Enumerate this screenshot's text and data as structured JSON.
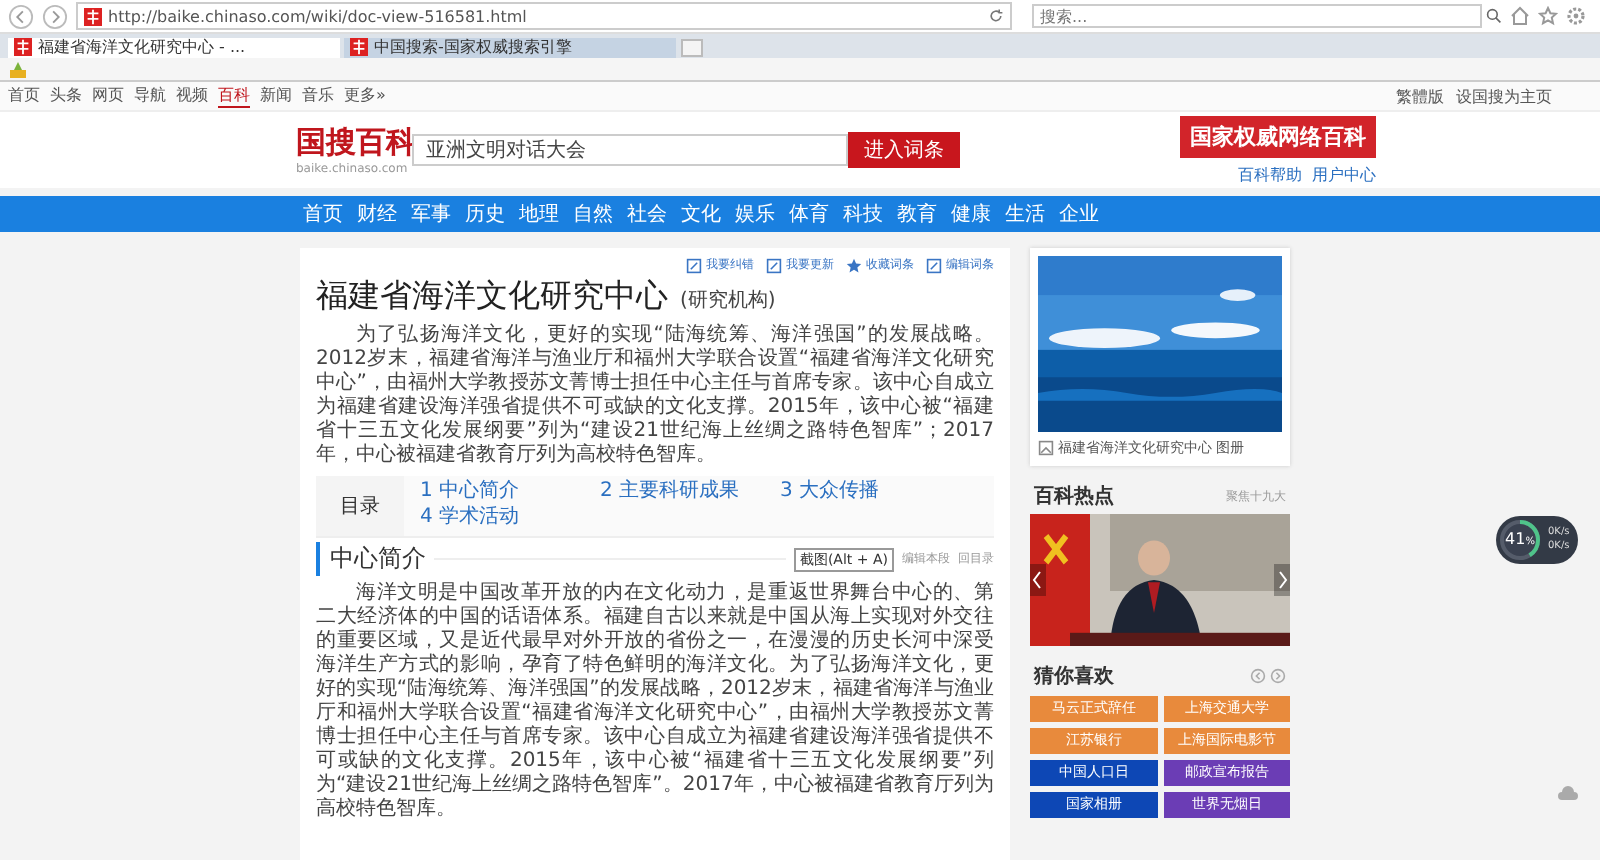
{
  "browser": {
    "url": "http://baike.chinaso.com/wiki/doc-view-516581.html",
    "search_placeholder": "搜索...",
    "tabs": [
      {
        "title": "福建省海洋文化研究中心 - ...",
        "selected": true
      },
      {
        "title": "中国搜索-国家权威搜索引擎",
        "selected": false
      }
    ]
  },
  "site": {
    "top_nav": [
      {
        "label": "首页",
        "selected": false
      },
      {
        "label": "头条",
        "selected": false
      },
      {
        "label": "网页",
        "selected": false
      },
      {
        "label": "导航",
        "selected": false
      },
      {
        "label": "视频",
        "selected": false
      },
      {
        "label": "百科",
        "selected": true
      },
      {
        "label": "新闻",
        "selected": false
      },
      {
        "label": "音乐",
        "selected": false
      },
      {
        "label": "更多»",
        "selected": false
      }
    ],
    "top_links": [
      "繁體版",
      "设国搜为主页"
    ],
    "logo": {
      "name": "国搜百科",
      "domain": "baike.chinaso.com"
    },
    "search": {
      "value": "亚洲文明对话大会",
      "button": "进入词条"
    },
    "banner": "国家权威网络百科",
    "header_links": [
      "百科帮助",
      "用户中心"
    ],
    "categories": [
      "首页",
      "财经",
      "军事",
      "历史",
      "地理",
      "自然",
      "社会",
      "文化",
      "娱乐",
      "体育",
      "科技",
      "教育",
      "健康",
      "生活",
      "企业"
    ]
  },
  "article": {
    "actions": [
      {
        "label": "我要纠错",
        "kind": "edit"
      },
      {
        "label": "我要更新",
        "kind": "edit"
      },
      {
        "label": "收藏词条",
        "kind": "star"
      },
      {
        "label": "编辑词条",
        "kind": "edit"
      }
    ],
    "title": "福建省海洋文化研究中心",
    "type": "(研究机构)",
    "intro": "为了弘扬海洋文化，更好的实现“陆海统筹、海洋强国”的发展战略。2012岁末，福建省海洋与渔业厅和福州大学联合设置“福建省海洋文化研究中心”，由福州大学教授苏文菁博士担任中心主任与首席专家。该中心自成立为福建省建设海洋强省提供不可或缺的文化支撑。2015年，该中心被“福建省十三五文化发展纲要”列为“建设21世纪海上丝绸之路特色智库”；2017年，中心被福建省教育厅列为高校特色智库。",
    "toc": {
      "label": "目录",
      "items": [
        "1 中心简介",
        "2 主要科研成果",
        "3 大众传播",
        "4 学术活动"
      ]
    },
    "sections": [
      {
        "title": "中心简介",
        "tools": [
          "编辑本段",
          "回目录"
        ],
        "paragraphs": [
          "海洋文明是中国改革开放的内在文化动力，是重返世界舞台中心的、第二大经济体的中国的话语体系。福建自古以来就是中国从海上实现对外交往的重要区域，又是近代最早对外开放的省份之一，在漫漫的历史长河中深受海洋生产方式的影响，孕育了特色鲜明的海洋文化。为了弘扬海洋文化，更好的实现“陆海统筹、海洋强国”的发展战略，2012岁末，福建省海洋与渔业厅和福州大学联合设置“福建省海洋文化研究中心”，由福州大学教授苏文菁博士担任中心主任与首席专家。该中心自成立为福建省建设海洋强省提供不可或缺的文化支撑。2015年，该中心被“福建省十三五文化发展纲要”列为“建设21世纪海上丝绸之路特色智库”。2017年，中心被福建省教育厅列为高校特色智库。"
        ]
      }
    ]
  },
  "tooltip": "截图(Alt + A)",
  "sidebar": {
    "album_caption": "福建省海洋文化研究中心 图册",
    "hot": {
      "title": "百科热点",
      "link": "聚焦十九大"
    },
    "guess": {
      "title": "猜你喜欢",
      "tags": [
        {
          "label": "马云正式辞任",
          "color": "#e88a3c"
        },
        {
          "label": "上海交通大学",
          "color": "#e88a3c"
        },
        {
          "label": "江苏银行",
          "color": "#e88a3c"
        },
        {
          "label": "上海国际电影节",
          "color": "#e88a3c"
        },
        {
          "label": "中国人口日",
          "color": "#0d47b5"
        },
        {
          "label": "邮政宣布报告",
          "color": "#6b3db5"
        },
        {
          "label": "国家相册",
          "color": "#0d47b5"
        },
        {
          "label": "世界无烟日",
          "color": "#6b3db5"
        }
      ]
    }
  },
  "widget": {
    "percent": "41",
    "unit": "%",
    "level": 0.41,
    "speeds": [
      "0K/s",
      "0K/s"
    ]
  }
}
